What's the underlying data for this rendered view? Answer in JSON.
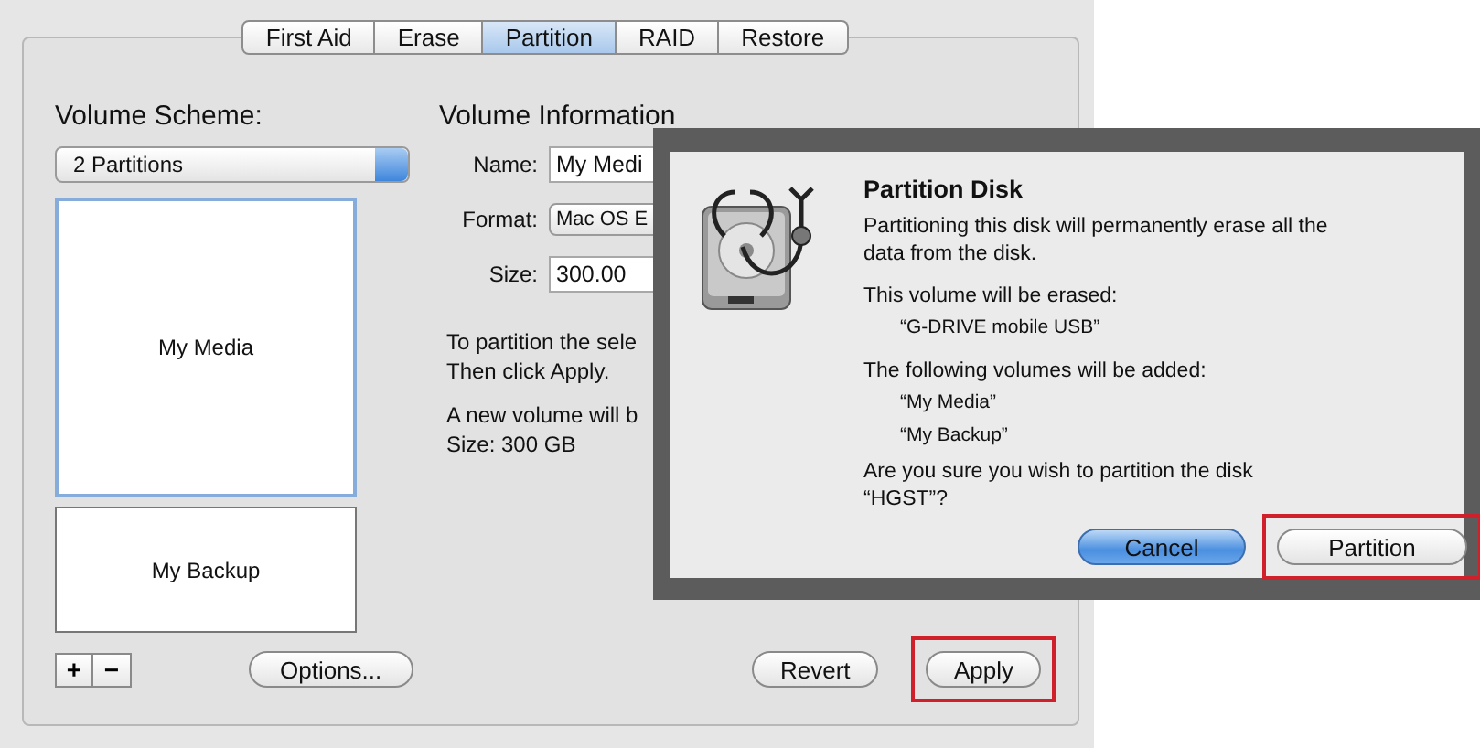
{
  "tabs": [
    {
      "label": "First Aid",
      "selected": false
    },
    {
      "label": "Erase",
      "selected": false
    },
    {
      "label": "Partition",
      "selected": true
    },
    {
      "label": "RAID",
      "selected": false
    },
    {
      "label": "Restore",
      "selected": false
    }
  ],
  "volume_scheme": {
    "label": "Volume Scheme:",
    "popup": "2 Partitions",
    "partitions": [
      {
        "name": "My Media",
        "selected": true
      },
      {
        "name": "My Backup",
        "selected": false
      }
    ],
    "add_button": "+",
    "remove_button": "−",
    "options_button": "Options..."
  },
  "volume_information": {
    "heading": "Volume Information",
    "fields": [
      {
        "label": "Name:",
        "value": "My Medi",
        "kind": "text"
      },
      {
        "label": "Format:",
        "value": "Mac OS E",
        "kind": "popup"
      },
      {
        "label": "Size:",
        "value": "300.00",
        "kind": "text"
      }
    ],
    "notes": [
      "To partition the sele\nThen click Apply.",
      "A new volume will b\nSize: 300 GB"
    ]
  },
  "buttons": [
    {
      "label": "Revert",
      "highlighted": false
    },
    {
      "label": "Apply",
      "highlighted": true
    }
  ],
  "dialog": {
    "title": "Partition Disk",
    "message": "Partitioning this disk will permanently erase all the\ndata from the disk.",
    "erase_label": "This volume will be erased:",
    "erased_volumes": [
      "“G-DRIVE mobile USB”"
    ],
    "add_label": "The following volumes will be added:",
    "added_volumes": [
      "“My Media”",
      "“My Backup”"
    ],
    "question": "Are you sure you wish to partition the disk\n“HGST”?",
    "buttons": [
      {
        "label": "Cancel",
        "default": true,
        "highlighted": false
      },
      {
        "label": "Partition",
        "default": false,
        "highlighted": true
      }
    ]
  }
}
